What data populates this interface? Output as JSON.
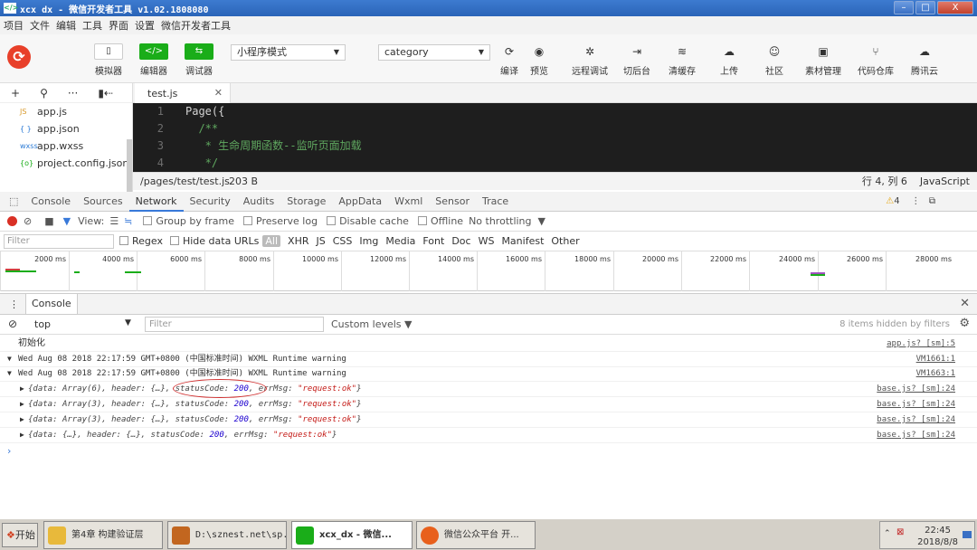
{
  "window": {
    "title": "xcx dx - 微信开发者工具 v1.02.1808080",
    "buttons": [
      "–",
      "□",
      "X"
    ]
  },
  "menu": [
    "项目",
    "文件",
    "编辑",
    "工具",
    "界面",
    "设置",
    "微信开发者工具"
  ],
  "toolbar": {
    "left_buttons": [
      {
        "glyph": "▯",
        "label": "模拟器"
      },
      {
        "glyph": "</>",
        "label": "编辑器"
      },
      {
        "glyph": "⇆",
        "label": "调试器"
      }
    ],
    "mode_select": "小程序模式",
    "compile_select": "category",
    "right_buttons": [
      {
        "glyph": "⟳",
        "label": "编译"
      },
      {
        "glyph": "◉",
        "label": "预览"
      },
      {
        "glyph": "✲",
        "label": "远程调试"
      },
      {
        "glyph": "⇥",
        "label": "切后台"
      },
      {
        "glyph": "≋",
        "label": "清缓存"
      },
      {
        "glyph": "☁",
        "label": "上传"
      },
      {
        "glyph": "☺",
        "label": "社区"
      },
      {
        "glyph": "▣",
        "label": "素材管理"
      },
      {
        "glyph": "⑂",
        "label": "代码仓库"
      },
      {
        "glyph": "☁",
        "label": "腾讯云"
      }
    ]
  },
  "filetree": {
    "tools": [
      "+",
      "⚲",
      "···",
      "▮⇠"
    ],
    "files": [
      {
        "icon": "JS",
        "name": "app.js"
      },
      {
        "icon": "{ }",
        "name": "app.json"
      },
      {
        "icon": "wxss",
        "name": "app.wxss"
      },
      {
        "icon": "{o}",
        "name": "project.config.json"
      }
    ]
  },
  "editor": {
    "tab": "test.js",
    "lines": [
      {
        "n": "1",
        "text": "Page({",
        "comment": false
      },
      {
        "n": "2",
        "text": "  /**",
        "comment": true
      },
      {
        "n": "3",
        "text": "   * 生命周期函数--监听页面加载",
        "comment": true
      },
      {
        "n": "4",
        "text": "   */",
        "comment": true
      }
    ],
    "status": {
      "path": "/pages/test/test.js",
      "size": "203 B",
      "position": "行 4, 列 6",
      "language": "JavaScript"
    }
  },
  "devtools": {
    "tabs": [
      "Console",
      "Sources",
      "Network",
      "Security",
      "Audits",
      "Storage",
      "AppData",
      "Wxml",
      "Sensor",
      "Trace"
    ],
    "active_tab": "Network",
    "warning_count": "4",
    "network_toolbar": {
      "view": "View:",
      "group": "Group by frame",
      "preserve": "Preserve log",
      "disable_cache": "Disable cache",
      "offline": "Offline",
      "throttling": "No throttling"
    },
    "filter_bar": {
      "placeholder": "Filter",
      "regex": "Regex",
      "hide_data": "Hide data URLs",
      "all": "All",
      "types": [
        "XHR",
        "JS",
        "CSS",
        "Img",
        "Media",
        "Font",
        "Doc",
        "WS",
        "Manifest",
        "Other"
      ]
    },
    "timeline_ticks": [
      "2000 ms",
      "4000 ms",
      "6000 ms",
      "8000 ms",
      "10000 ms",
      "12000 ms",
      "14000 ms",
      "16000 ms",
      "18000 ms",
      "20000 ms",
      "22000 ms",
      "24000 ms",
      "26000 ms",
      "28000 ms"
    ]
  },
  "console": {
    "drawer_tab": "Console",
    "context": "top",
    "filter_placeholder": "Filter",
    "levels": "Custom levels ▼",
    "hidden": "8 items hidden by filters",
    "logs": [
      {
        "kind": "plain",
        "text": "初始化",
        "src": "app.js? [sm]:5"
      },
      {
        "kind": "warn",
        "text": "Wed Aug 08 2018 22:17:59 GMT+0800 (中国标准时间) WXML Runtime warning",
        "src": "VM1661:1"
      },
      {
        "kind": "warn",
        "text": "Wed Aug 08 2018 22:17:59 GMT+0800 (中国标准时间) WXML Runtime warning",
        "src": "VM1663:1"
      },
      {
        "kind": "obj",
        "data": "Array(6)",
        "status": "200",
        "errmsg": "\"request:ok\"",
        "src": "base.js? [sm]:24"
      },
      {
        "kind": "obj",
        "data": "Array(3)",
        "status": "200",
        "errmsg": "\"request:ok\"",
        "src": "base.js? [sm]:24"
      },
      {
        "kind": "obj",
        "data": "Array(3)",
        "status": "200",
        "errmsg": "\"request:ok\"",
        "src": "base.js? [sm]:24"
      },
      {
        "kind": "obj",
        "data": "{…}",
        "status": "200",
        "errmsg": "\"request:ok\"",
        "src": "base.js? [sm]:24"
      }
    ]
  },
  "taskbar": {
    "start": "开始",
    "tasks": [
      {
        "label": "第4章 构建验证层",
        "color": "#e8b93b"
      },
      {
        "label": "D:\\sznest.net\\sp...",
        "color": "#c2661f"
      },
      {
        "label": "xcx_dx - 微信...",
        "color": "#1aad19"
      },
      {
        "label": "微信公众平台 开...",
        "color": "#e8601c"
      }
    ],
    "time": "22:45",
    "date": "2018/8/8"
  }
}
